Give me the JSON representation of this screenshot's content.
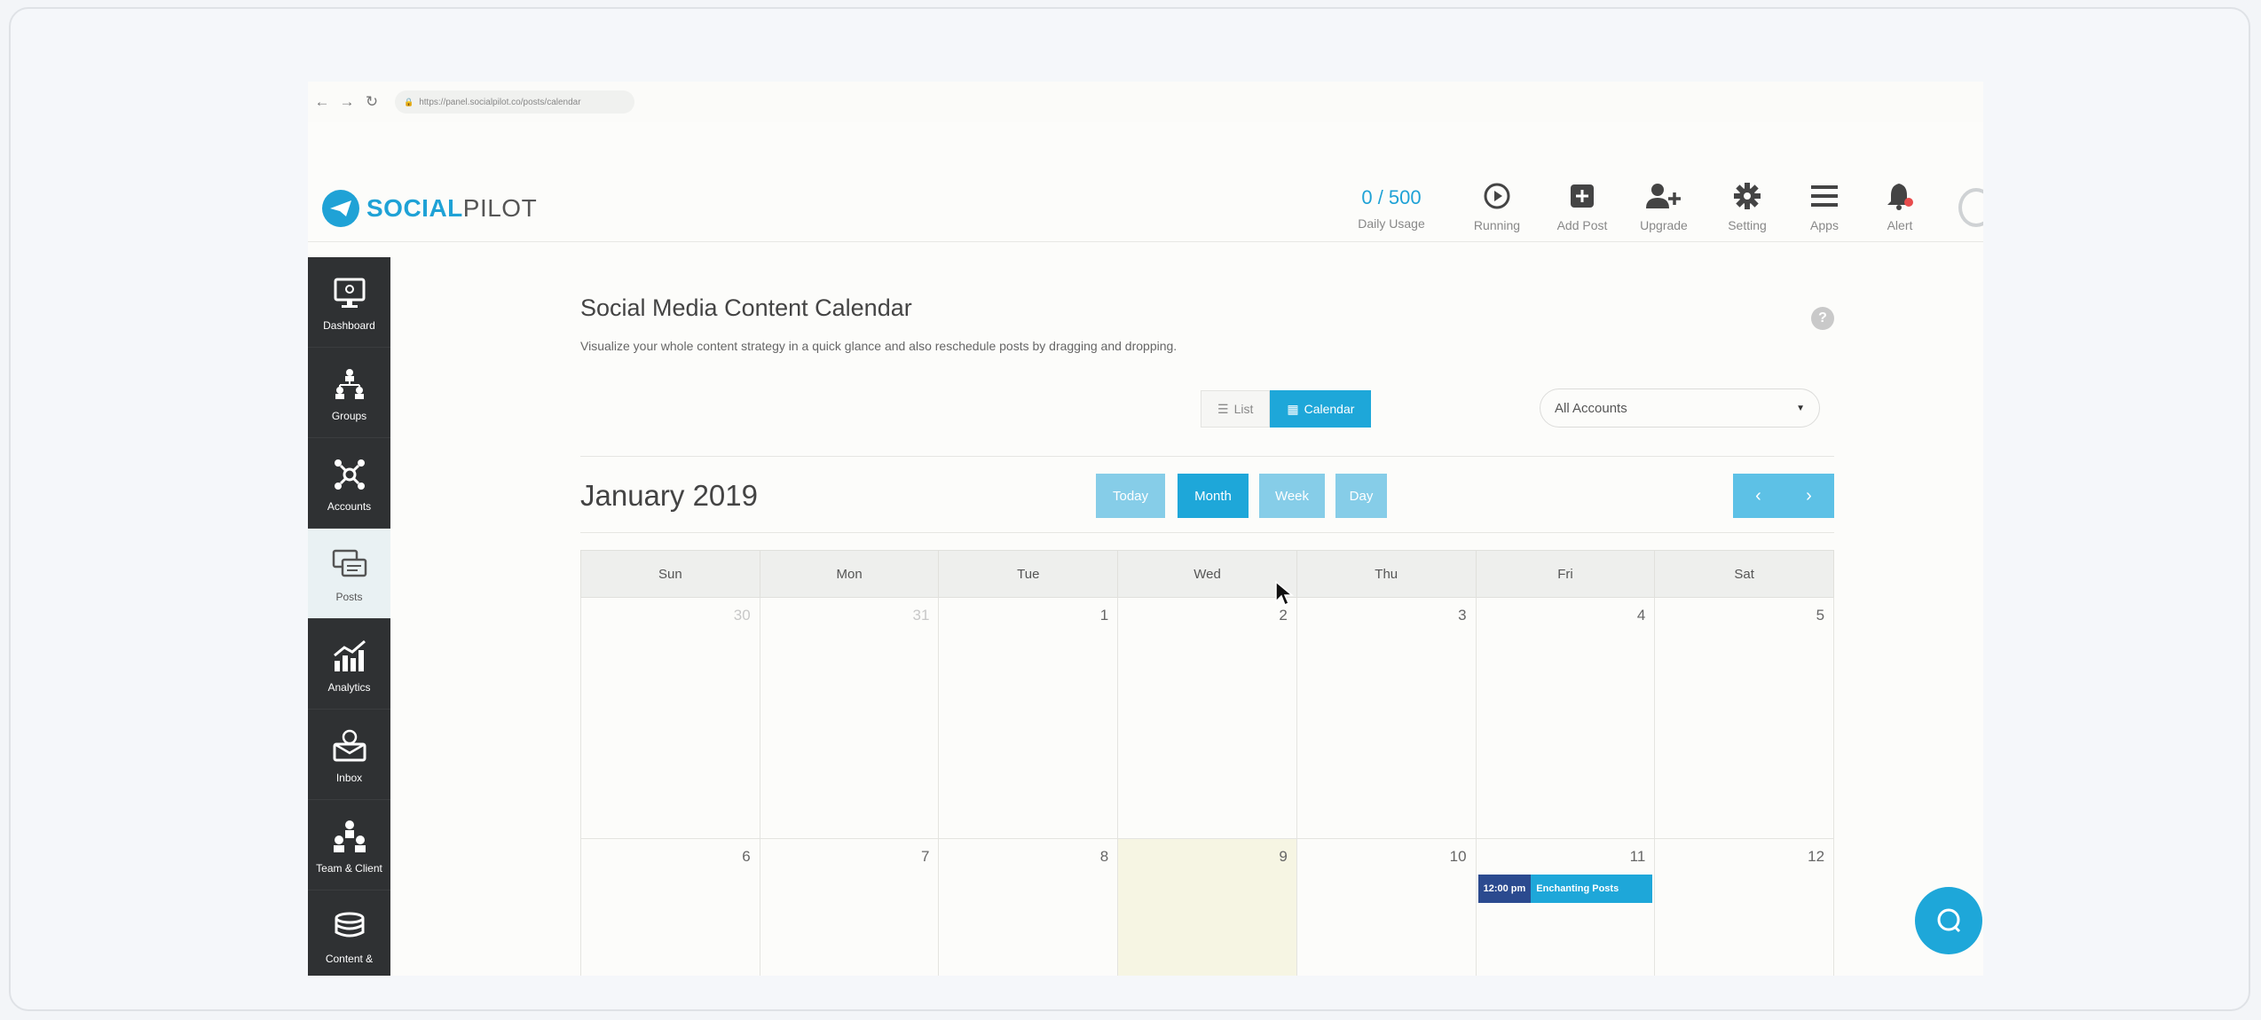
{
  "browser": {
    "url": "https://panel.socialpilot.co/posts/calendar"
  },
  "header": {
    "logo_social": "SOCIAL",
    "logo_pilot": "PILOT",
    "usage_count": "0 / 500",
    "usage_label": "Daily Usage",
    "items": [
      {
        "label": "Running",
        "icon": "play-circle-icon"
      },
      {
        "label": "Add Post",
        "icon": "plus-square-icon"
      },
      {
        "label": "Upgrade",
        "icon": "user-plus-icon"
      },
      {
        "label": "Setting",
        "icon": "gear-icon"
      },
      {
        "label": "Apps",
        "icon": "menu-icon"
      },
      {
        "label": "Alert",
        "icon": "bell-icon"
      }
    ]
  },
  "sidebar": {
    "items": [
      {
        "label": "Dashboard",
        "icon": "monitor-icon"
      },
      {
        "label": "Groups",
        "icon": "groups-icon"
      },
      {
        "label": "Accounts",
        "icon": "accounts-icon"
      },
      {
        "label": "Posts",
        "icon": "posts-icon",
        "active": true
      },
      {
        "label": "Analytics",
        "icon": "analytics-icon"
      },
      {
        "label": "Inbox",
        "icon": "inbox-icon"
      },
      {
        "label": "Team & Client",
        "icon": "team-icon"
      },
      {
        "label": "Content &",
        "icon": "content-icon"
      }
    ]
  },
  "page": {
    "title": "Social Media Content Calendar",
    "subtitle": "Visualize your whole content strategy in a quick glance and also reschedule posts by dragging and dropping.",
    "view_list": "List",
    "view_calendar": "Calendar",
    "accounts_select": "All Accounts"
  },
  "calendar": {
    "month_title": "January 2019",
    "today_btn": "Today",
    "month_btn": "Month",
    "week_btn": "Week",
    "day_btn": "Day",
    "prev": "‹",
    "next": "›",
    "weekdays": [
      "Sun",
      "Mon",
      "Tue",
      "Wed",
      "Thu",
      "Fri",
      "Sat"
    ],
    "week1": [
      "30",
      "31",
      "1",
      "2",
      "3",
      "4",
      "5"
    ],
    "week2": [
      "6",
      "7",
      "8",
      "9",
      "10",
      "11",
      "12"
    ],
    "event_time": "12:00 pm",
    "event_title": "Enchanting Posts"
  },
  "colors": {
    "accent": "#1ea7d9",
    "sidebar": "#2f3133",
    "today": "#f6f5e3",
    "event_time": "#2b4a8f"
  }
}
